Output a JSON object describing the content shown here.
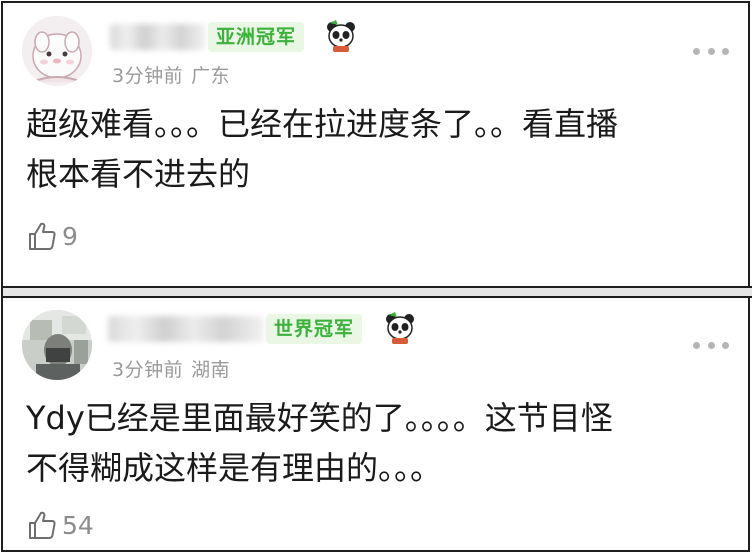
{
  "comments": [
    {
      "badge": "亚洲冠军",
      "time": "3分钟前",
      "location": "广东",
      "lines": [
        "超级难看。。。已经在拉进度条了。。看直播",
        "根本看不进去的"
      ],
      "likes": "9"
    },
    {
      "badge": "世界冠军",
      "time": "3分钟前",
      "location": "湖南",
      "lines": [
        "Ydy已经是里面最好笑的了。。。。这节目怪",
        "不得糊成这样是有理由的。。。"
      ],
      "likes": "54"
    }
  ],
  "icons": {
    "more": "more-dots-icon",
    "like": "thumbs-up-icon",
    "badge_emblem": "panda-mascot-icon",
    "avatar_1": "cartoon-character-avatar",
    "avatar_2": "photo-avatar"
  },
  "colors": {
    "badge_bg": "#e9f7e4",
    "badge_text": "#3cb13c",
    "meta_text": "#9a9a9a",
    "body_text": "#1a1a1a"
  }
}
